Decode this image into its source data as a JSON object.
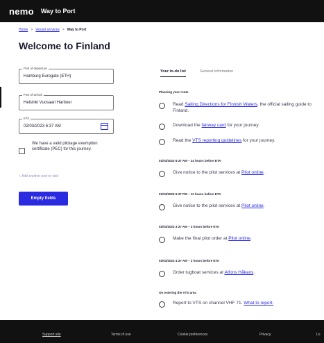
{
  "header": {
    "brand": "nemo",
    "app_title": "Way to Port"
  },
  "breadcrumb": {
    "home": "Home",
    "sep1": ">",
    "vessel_services": "Vessel services",
    "sep2": ">",
    "current": "Way to Port"
  },
  "page_title": "Welcome to Finland",
  "form": {
    "departure": {
      "label": "Port of departure",
      "value": "Hamburg Eurogate (ETH)"
    },
    "arrival": {
      "label": "Port of arrival",
      "value": "Helsinki Vuosaari Harbour"
    },
    "eta": {
      "label": "ETA",
      "value": "02/03/2023  6:37 AM"
    },
    "pec_text": "We have a valid pilotage exemption certificate (PEC) for this journey.",
    "add_port": "+ Add another port to visit",
    "empty_button": "Empty fields"
  },
  "tabs": {
    "todo": "Your to-do list",
    "general": "General information"
  },
  "todo": {
    "planning": {
      "title": "Planning your route",
      "items": [
        {
          "pre": "Read ",
          "link": "Sailing Directions for Finnish Waters",
          "post": ", the official sailing guide to Finland."
        },
        {
          "pre": "Download the ",
          "link": "fairway card",
          "post": " for your journey."
        },
        {
          "pre": "Read the ",
          "link": "VTS reporting guidelines",
          "post": " for your journey."
        }
      ]
    },
    "pilot24": {
      "title": "01/03/2023  6:37 AM – 24 hours before ETA",
      "pre": "Give notice to the pilot services at ",
      "link": "Pilot online",
      "post": "."
    },
    "pilot12": {
      "title": "01/03/2023  6:37 PM – 12 hours before ETA",
      "pre": "Give notice to the pilot services at ",
      "link": "Pilot online",
      "post": "."
    },
    "pilot3": {
      "title": "02/03/2023  3:37 AM – 3 hours before ETA",
      "pre": "Make the final pilot order at ",
      "link": "Pilot online",
      "post": "."
    },
    "tug": {
      "title": "02/03/2023  4:37 AM – 2 hours before ETA",
      "pre": "Order tugboat services at ",
      "link": "Alfons Håkans",
      "post": "."
    },
    "vts": {
      "title": "On entering the VTS area",
      "pre": "Report to VTS on channel VHF 71. ",
      "link": "What to report.",
      "post": ""
    }
  },
  "footer": {
    "support": "Support site",
    "terms": "Terms of use",
    "cookies": "Cookie preferences",
    "privacy": "Privacy",
    "last": "Lo"
  },
  "colors": {
    "accent": "#2a2ae0",
    "header_bg": "#111111"
  }
}
